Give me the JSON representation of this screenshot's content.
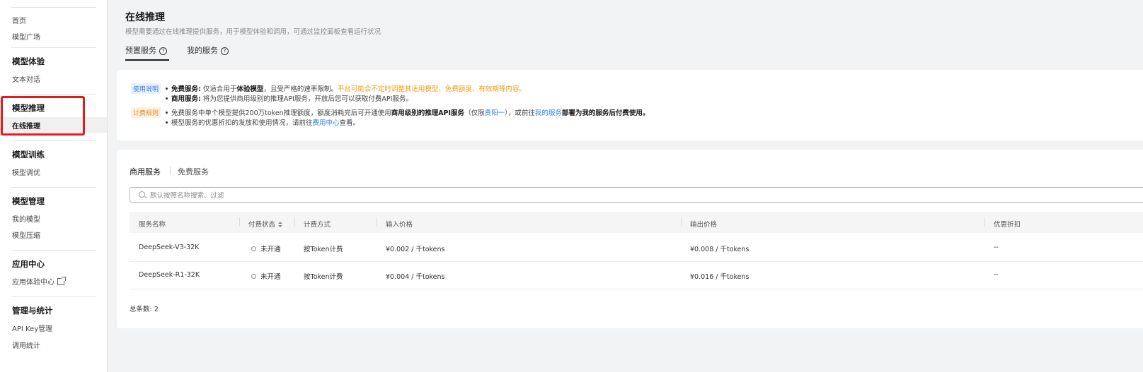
{
  "sidebar": {
    "items_top": [
      "首页",
      "模型广场"
    ],
    "sections": [
      {
        "title": "模型体验",
        "items": [
          "文本对话"
        ]
      },
      {
        "title": "模型推理",
        "items": [
          "在线推理"
        ]
      },
      {
        "title": "模型训练",
        "items": [
          "模型调优"
        ]
      },
      {
        "title": "模型管理",
        "items": [
          "我的模型",
          "模型压缩"
        ]
      },
      {
        "title": "应用中心",
        "items": [
          "应用体验中心"
        ]
      },
      {
        "title": "管理与统计",
        "items": [
          "API Key管理",
          "调用统计"
        ]
      }
    ],
    "active_item": "在线推理",
    "highlight_color": "#e8191b"
  },
  "header": {
    "title": "在线推理",
    "description": "模型需要通过在线推理提供服务，用于模型体验和调用，可通过监控面板查看运行状况",
    "tabs": [
      {
        "label": "预置服务",
        "active": true
      },
      {
        "label": "我的服务",
        "active": false
      }
    ]
  },
  "notice": {
    "usage_tag": "使用说明",
    "usage_lines": {
      "free_label": "免费服务:",
      "free_text1": " 仅适合用于",
      "free_bold": "体验模型",
      "free_text2": "，且受严格的速率限制。",
      "free_warn": "平台可能会不定时调整其适用模型、免费额度、有效期等内容。",
      "commercial_label": "商用服务:",
      "commercial_text": " 将为您提供商用级别的推理API服务，开放后您可以获取付费API服务。"
    },
    "billing_tag": "计费规则",
    "billing_lines": {
      "line1_a": "免费服务中单个模型提供200万token推理额度，额度消耗完后可开通使用",
      "line1_bold": "商用级别的推理API服务",
      "line1_b": "（仅限",
      "line1_link1": "贵阳一",
      "line1_c": "），或前往",
      "line1_link2": "我的服务",
      "line1_bold2": "部署为我的服务后付费使用。",
      "line2_a": "模型服务的优惠折扣的发放和使用情况，请前往",
      "line2_link": "费用中心",
      "line2_b": "查看。"
    }
  },
  "services": {
    "subtabs": [
      {
        "label": "商用服务",
        "active": true
      },
      {
        "label": "免费服务",
        "active": false
      }
    ],
    "search_placeholder": "默认按照名称搜索、过滤",
    "columns": [
      "服务名称",
      "付费状态",
      "计费方式",
      "输入价格",
      "输出价格",
      "优惠折扣"
    ],
    "rows": [
      {
        "name": "DeepSeek-V3-32K",
        "status": "未开通",
        "billing": "按Token计费",
        "input_price": "¥0.002 / 千tokens",
        "output_price": "¥0.008 / 千tokens",
        "discount": "--"
      },
      {
        "name": "DeepSeek-R1-32K",
        "status": "未开通",
        "billing": "按Token计费",
        "input_price": "¥0.004 / 千tokens",
        "output_price": "¥0.016 / 千tokens",
        "discount": "--"
      }
    ],
    "total": "总条数: 2"
  }
}
